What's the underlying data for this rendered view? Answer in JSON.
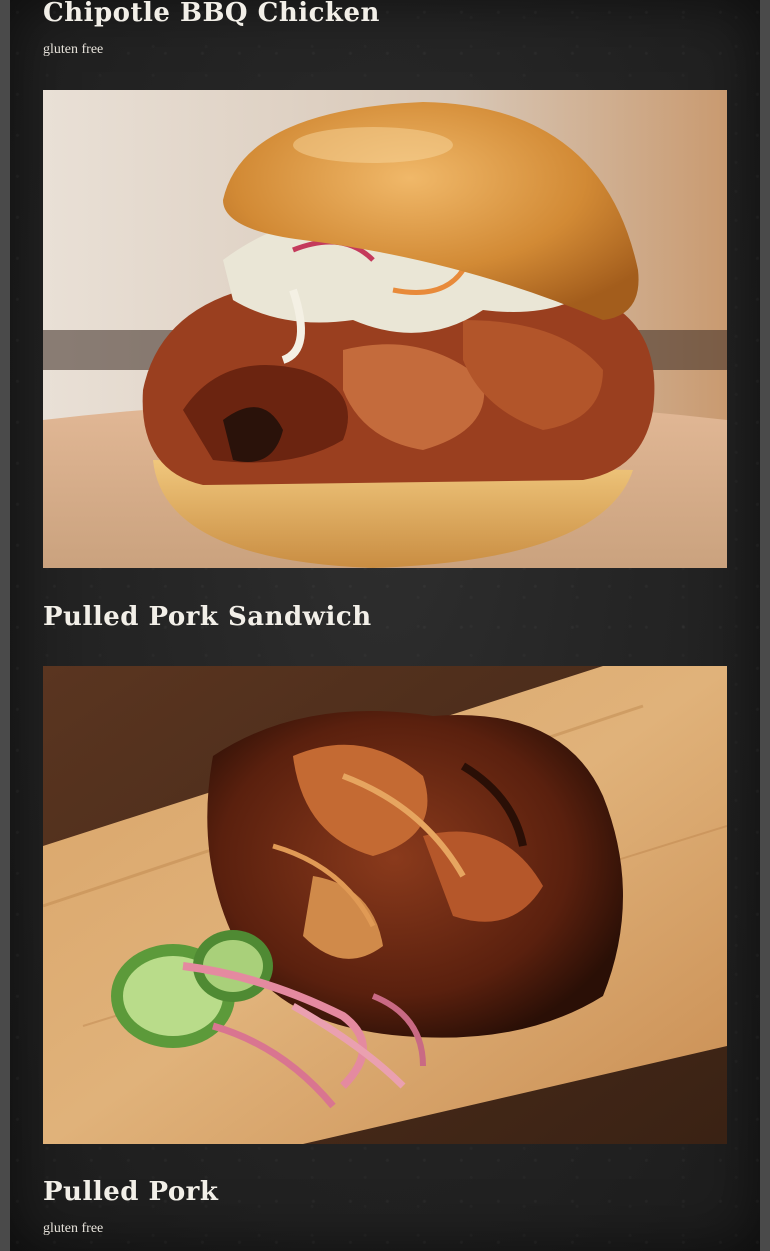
{
  "menu": {
    "items": [
      {
        "title": "Chipotle BBQ Chicken",
        "tag": "gluten free"
      },
      {
        "title": "Pulled Pork Sandwich",
        "photo_icon": "pulled-pork-sandwich-photo"
      },
      {
        "title": "Pulled Pork",
        "tag": "gluten free",
        "photo_icon": "pulled-pork-photo"
      }
    ]
  },
  "theme": {
    "background": "#252525",
    "text": "#f2efe8"
  }
}
